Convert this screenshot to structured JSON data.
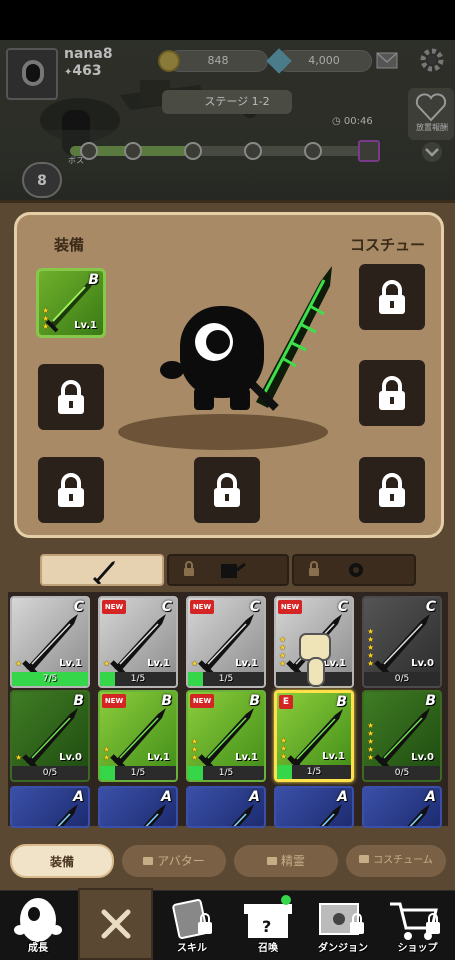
{
  "player": {
    "name": "nana8",
    "level": "463"
  },
  "currency": {
    "gold": "848",
    "gems": "4,000"
  },
  "stage": {
    "label": "ステージ 1-2",
    "timer": "00:46",
    "boss_label": "ボス"
  },
  "side_button": {
    "label": "放置報酬"
  },
  "hero_badge": "8",
  "equip_panel": {
    "left_title": "装備",
    "right_title": "コスチュー"
  },
  "equipped_weapon": {
    "grade": "B",
    "level": "Lv.1",
    "stars": 3
  },
  "subtabs": [
    {
      "name": "weapon",
      "locked": false
    },
    {
      "name": "armor",
      "locked": true
    },
    {
      "name": "pet",
      "locked": true
    }
  ],
  "items": [
    {
      "grade": "C",
      "level": "Lv.1",
      "progress": "7/5",
      "fill": 1.0,
      "new": false,
      "e": false,
      "stars": 1,
      "color": "gray"
    },
    {
      "grade": "C",
      "level": "Lv.1",
      "progress": "1/5",
      "fill": 0.2,
      "new": true,
      "e": false,
      "stars": 1,
      "color": "gray"
    },
    {
      "grade": "C",
      "level": "Lv.1",
      "progress": "1/5",
      "fill": 0.2,
      "new": true,
      "e": false,
      "stars": 1,
      "color": "gray"
    },
    {
      "grade": "C",
      "level": "Lv.1",
      "progress": "",
      "fill": 0,
      "new": true,
      "e": false,
      "stars": 4,
      "color": "gray"
    },
    {
      "grade": "C",
      "level": "Lv.0",
      "progress": "0/5",
      "fill": 0,
      "new": false,
      "e": false,
      "stars": 5,
      "color": "dark"
    },
    {
      "grade": "B",
      "level": "Lv.0",
      "progress": "0/5",
      "fill": 0,
      "new": false,
      "e": false,
      "stars": 1,
      "color": "dgreen"
    },
    {
      "grade": "B",
      "level": "Lv.1",
      "progress": "1/5",
      "fill": 0.2,
      "new": true,
      "e": false,
      "stars": 2,
      "color": "green"
    },
    {
      "grade": "B",
      "level": "Lv.1",
      "progress": "1/5",
      "fill": 0.2,
      "new": true,
      "e": false,
      "stars": 3,
      "color": "green"
    },
    {
      "grade": "B",
      "level": "Lv.1",
      "progress": "1/5",
      "fill": 0.2,
      "new": false,
      "e": true,
      "stars": 3,
      "color": "green",
      "selected": true
    },
    {
      "grade": "B",
      "level": "Lv.0",
      "progress": "0/5",
      "fill": 0,
      "new": false,
      "e": false,
      "stars": 5,
      "color": "dgreen"
    },
    {
      "grade": "A",
      "color": "blue"
    },
    {
      "grade": "A",
      "color": "blue"
    },
    {
      "grade": "A",
      "color": "blue"
    },
    {
      "grade": "A",
      "color": "blue"
    },
    {
      "grade": "A",
      "color": "blue"
    }
  ],
  "category_tabs": {
    "equip": "装備",
    "avatar": "アバター",
    "spirit": "精霊",
    "costume": "コスチューム"
  },
  "nav": {
    "growth": "成長",
    "skill": "スキル",
    "summon": "召喚",
    "dungeon": "ダンジョン",
    "shop": "ショップ"
  },
  "colors": {
    "accent_green": "#35d64a",
    "panel_brown": "#5a4833",
    "equip_bg": "#a88b66",
    "selected_gold": "#ffe14a",
    "new_red": "#d42424"
  }
}
